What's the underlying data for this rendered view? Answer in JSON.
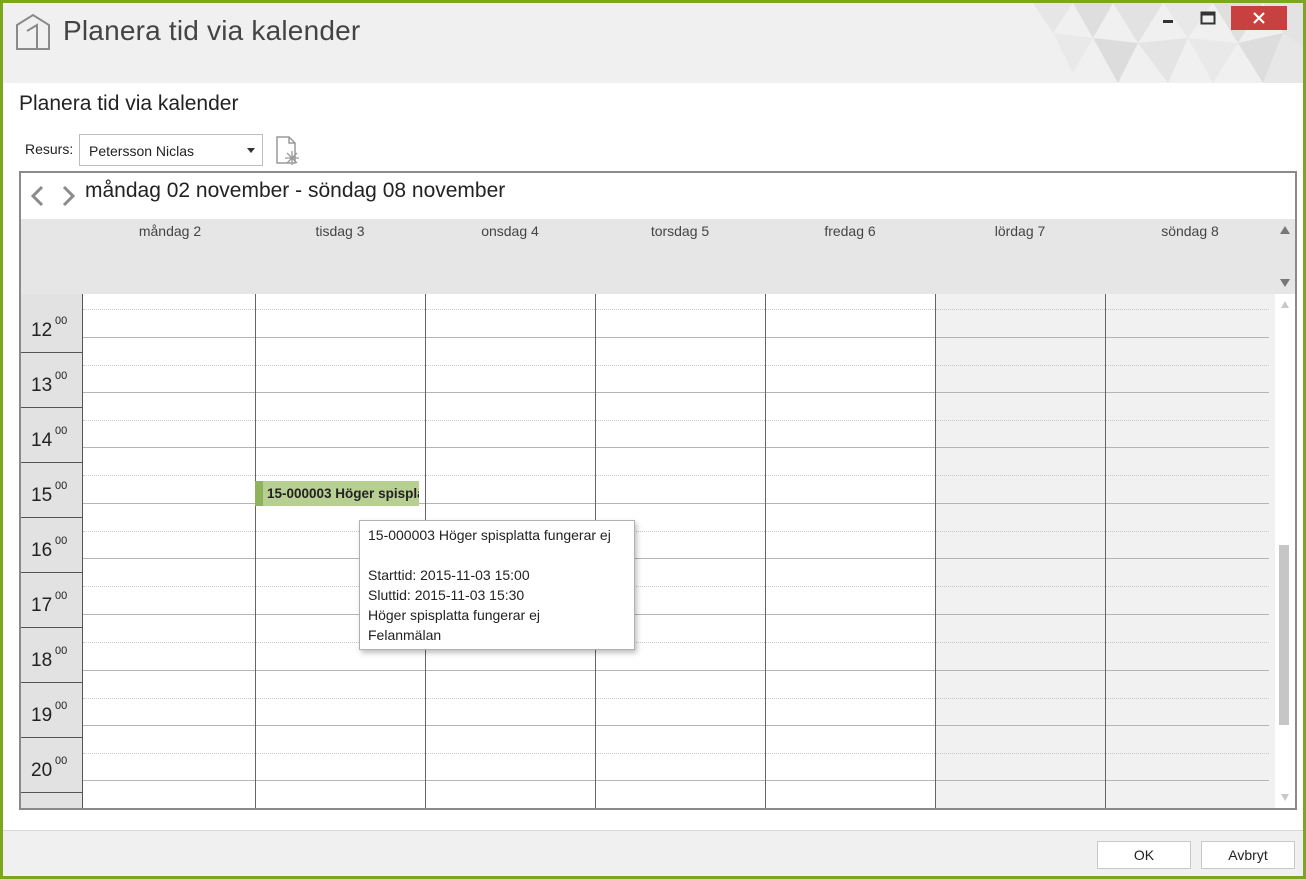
{
  "window": {
    "title": "Planera tid via kalender",
    "accent": "#7ba61e",
    "close_color": "#c94040"
  },
  "page": {
    "title": "Planera tid via kalender"
  },
  "resource": {
    "label": "Resurs:",
    "selected": "Petersson Niclas"
  },
  "calendar": {
    "range_title": "måndag 02 november - söndag 08 november",
    "days": [
      "måndag 2",
      "tisdag 3",
      "onsdag 4",
      "torsdag 5",
      "fredag 6",
      "lördag 7",
      "söndag 8"
    ],
    "hours": [
      "12",
      "13",
      "14",
      "15",
      "16",
      "17",
      "18",
      "19",
      "20"
    ],
    "minutes_label": "00",
    "event": {
      "label": "15-000003 Höger spisplatta fungerar ej",
      "color": "#b8cf92"
    }
  },
  "tooltip": {
    "title": "15-000003 Höger spisplatta fungerar ej",
    "start": "Starttid: 2015-11-03 15:00",
    "end": "Sluttid: 2015-11-03 15:30",
    "description": "Höger spisplatta fungerar ej",
    "category": "Felanmälan"
  },
  "footer": {
    "ok_label": "OK",
    "cancel_label": "Avbryt"
  }
}
